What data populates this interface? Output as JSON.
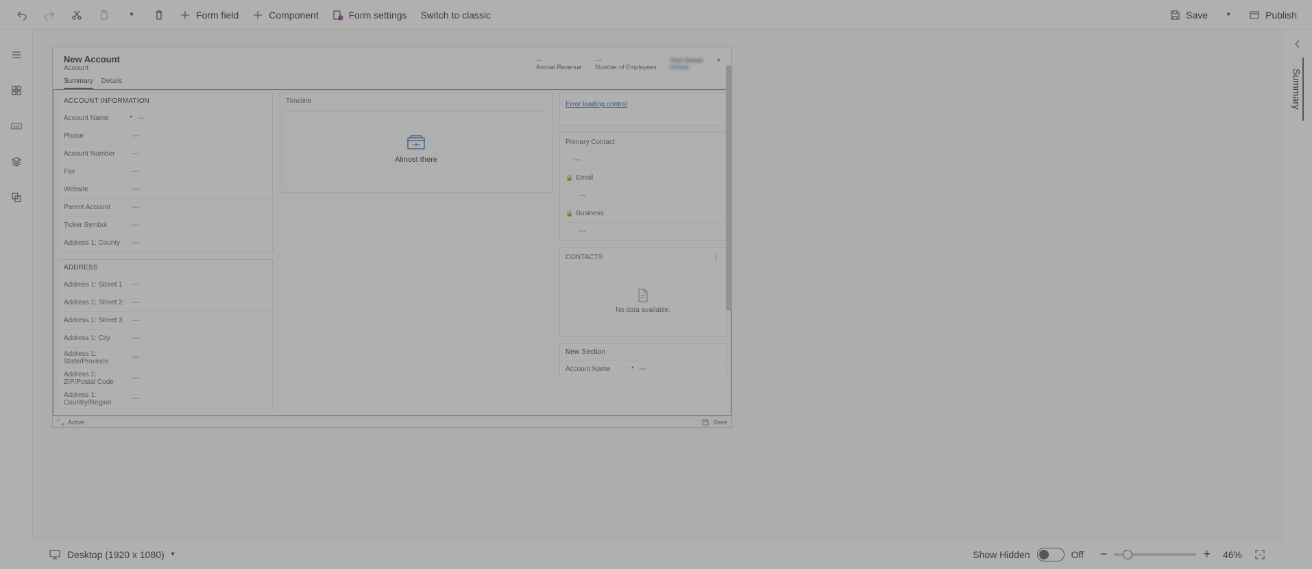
{
  "cmdbar": {
    "form_field": "Form field",
    "component": "Component",
    "form_settings": "Form settings",
    "switch_classic": "Switch to classic",
    "save": "Save",
    "publish": "Publish"
  },
  "right_tab": "Summary",
  "form": {
    "title": "New Account",
    "subtitle": "Account",
    "header_stats": {
      "annual_revenue": {
        "label": "Annual Revenue",
        "value": "---"
      },
      "num_employees": {
        "label": "Number of Employees",
        "value": "---"
      },
      "owner": {
        "label": "Owner",
        "value": "Test Owner"
      }
    },
    "tabs": {
      "summary": "Summary",
      "details": "Details"
    },
    "sections": {
      "account_info": {
        "title": "ACCOUNT INFORMATION",
        "fields": {
          "account_name": "Account Name",
          "phone": "Phone",
          "account_number": "Account Number",
          "fax": "Fax",
          "website": "Website",
          "parent_account": "Parent Account",
          "ticker_symbol": "Ticker Symbol",
          "addr_county": "Address 1: County"
        }
      },
      "address": {
        "title": "ADDRESS",
        "fields": {
          "street1": "Address 1: Street 1",
          "street2": "Address 1: Street 2",
          "street3": "Address 1: Street 3",
          "city": "Address 1: City",
          "state": "Address 1: State/Province",
          "zip": "Address 1: ZIP/Postal Code",
          "country": "Address 1: Country/Region"
        }
      },
      "timeline": {
        "title": "Timeline",
        "msg": "Almost there"
      },
      "error": "Error loading control",
      "contact_card": {
        "primary_contact": "Primary Contact",
        "email": "Email",
        "business": "Business"
      },
      "contacts": {
        "title": "CONTACTS",
        "empty": "No data available."
      },
      "new_section": {
        "title": "New Section",
        "account_name": "Account Name"
      }
    },
    "placeholder": "---",
    "footer": {
      "active": "Active",
      "save": "Save"
    }
  },
  "statusbar": {
    "device": "Desktop (1920 x 1080)",
    "show_hidden": "Show Hidden",
    "toggle_state": "Off",
    "zoom_pct": "46%"
  }
}
